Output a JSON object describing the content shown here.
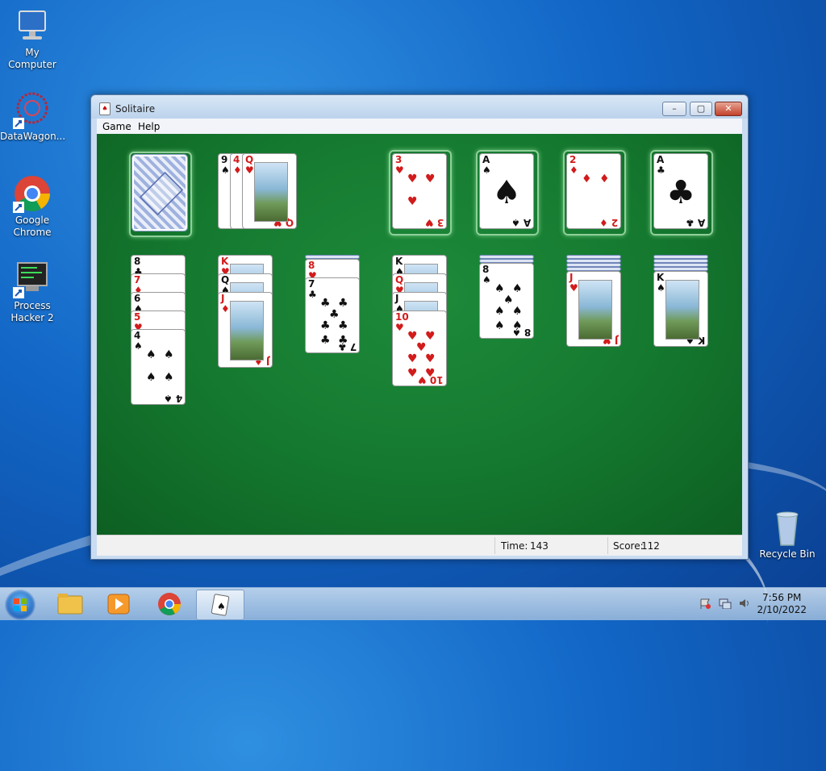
{
  "desktop": {
    "icons": [
      {
        "label": "My Computer",
        "icon": "computer-icon"
      },
      {
        "label": "DataWagon...",
        "icon": "datawagon-icon"
      },
      {
        "label": "Google Chrome",
        "icon": "chrome-icon"
      },
      {
        "label": "Process Hacker 2",
        "icon": "process-hacker-icon"
      },
      {
        "label": "Recycle Bin",
        "icon": "recycle-bin-icon"
      }
    ]
  },
  "window": {
    "title": "Solitaire",
    "menu": [
      "Game",
      "Help"
    ],
    "controls": {
      "minimize": "–",
      "maximize": "▢",
      "close": "✕"
    }
  },
  "game": {
    "stock": {
      "face_down": true
    },
    "waste": [
      {
        "rank": "9",
        "suit": "♠",
        "color": "black"
      },
      {
        "rank": "4",
        "suit": "♦",
        "color": "red"
      },
      {
        "rank": "Q",
        "suit": "♥",
        "color": "red"
      }
    ],
    "foundations": [
      {
        "rank": "3",
        "suit": "♥",
        "color": "red"
      },
      {
        "rank": "A",
        "suit": "♠",
        "color": "black"
      },
      {
        "rank": "2",
        "suit": "♦",
        "color": "red"
      },
      {
        "rank": "A",
        "suit": "♣",
        "color": "black"
      }
    ],
    "tableau": [
      {
        "hidden": 0,
        "face_up": [
          {
            "rank": "8",
            "suit": "♣",
            "color": "black"
          },
          {
            "rank": "7",
            "suit": "♦",
            "color": "red"
          },
          {
            "rank": "6",
            "suit": "♠",
            "color": "black"
          },
          {
            "rank": "5",
            "suit": "♥",
            "color": "red"
          },
          {
            "rank": "4",
            "suit": "♠",
            "color": "black"
          }
        ]
      },
      {
        "hidden": 0,
        "face_up": [
          {
            "rank": "K",
            "suit": "♥",
            "color": "red"
          },
          {
            "rank": "Q",
            "suit": "♠",
            "color": "black"
          },
          {
            "rank": "J",
            "suit": "♦",
            "color": "red"
          }
        ]
      },
      {
        "hidden": 1,
        "face_up": [
          {
            "rank": "8",
            "suit": "♥",
            "color": "red"
          },
          {
            "rank": "7",
            "suit": "♣",
            "color": "black"
          }
        ]
      },
      {
        "hidden": 0,
        "face_up": [
          {
            "rank": "K",
            "suit": "♠",
            "color": "black"
          },
          {
            "rank": "Q",
            "suit": "♥",
            "color": "red"
          },
          {
            "rank": "J",
            "suit": "♠",
            "color": "black"
          },
          {
            "rank": "10",
            "suit": "♥",
            "color": "red"
          }
        ]
      },
      {
        "hidden": 2,
        "face_up": [
          {
            "rank": "8",
            "suit": "♠",
            "color": "black"
          }
        ]
      },
      {
        "hidden": 4,
        "face_up": [
          {
            "rank": "J",
            "suit": "♥",
            "color": "red"
          }
        ]
      },
      {
        "hidden": 4,
        "face_up": [
          {
            "rank": "K",
            "suit": "♠",
            "color": "black"
          }
        ]
      }
    ]
  },
  "status": {
    "time_label": "Time:",
    "time_value": "143",
    "score_label": "Score:",
    "score_value": "112"
  },
  "taskbar": {
    "items": [
      "start-orb",
      "file-explorer",
      "media-player",
      "chrome",
      "solitaire"
    ],
    "time": "7:56 PM",
    "date": "2/10/2022"
  }
}
